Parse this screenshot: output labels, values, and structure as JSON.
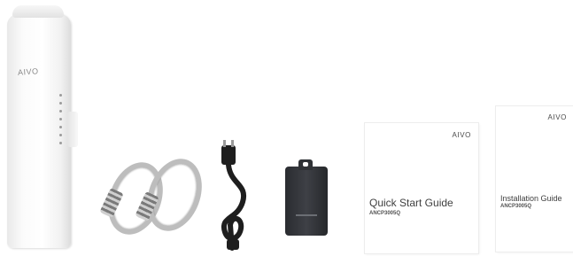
{
  "cpe": {
    "logo_text": "AIVO"
  },
  "quick_start": {
    "brand": "AIVO",
    "title": "Quick Start Guide",
    "model": "ANCP3005Q"
  },
  "installation": {
    "brand": "AIVO",
    "title": "Installation Guide",
    "model": "ANCP3005Q"
  },
  "colors": {
    "background": "#ffffff",
    "adapter": "#2f3135",
    "cord": "#1e1e1e",
    "clamp": "#bdbdbd"
  }
}
